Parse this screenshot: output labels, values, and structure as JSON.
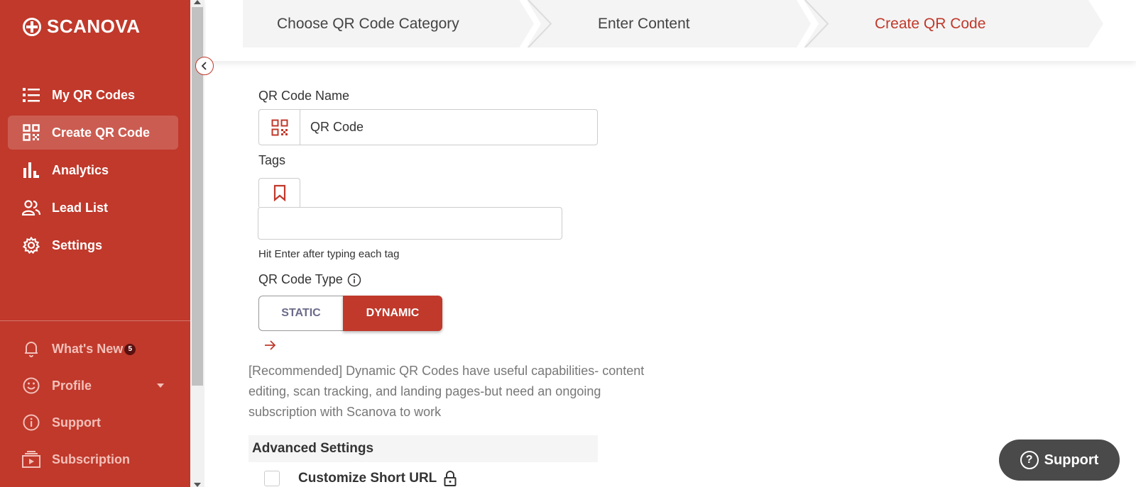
{
  "brand": {
    "name": "SCANOVA"
  },
  "sidebar": {
    "items": [
      {
        "label": "My QR Codes",
        "icon": "list-icon"
      },
      {
        "label": "Create QR Code",
        "icon": "qr-icon",
        "active": true
      },
      {
        "label": "Analytics",
        "icon": "bar-chart-icon"
      },
      {
        "label": "Lead List",
        "icon": "users-icon"
      },
      {
        "label": "Settings",
        "icon": "gear-icon"
      }
    ],
    "bottom": [
      {
        "label": "What's New",
        "icon": "bell-icon",
        "badge": "5"
      },
      {
        "label": "Profile",
        "icon": "smiley-icon"
      },
      {
        "label": "Support",
        "icon": "info-icon"
      },
      {
        "label": "Subscription",
        "icon": "subscription-icon"
      }
    ]
  },
  "stepper": {
    "steps": [
      "Choose QR Code Category",
      "Enter Content",
      "Create QR Code"
    ],
    "active_index": 2
  },
  "form": {
    "name_label": "QR Code Name",
    "name_value": "QR Code",
    "tags_label": "Tags",
    "tags_value": "",
    "tags_hint": "Hit Enter after typing each tag",
    "type_label": "QR Code Type",
    "type_options": [
      "STATIC",
      "DYNAMIC"
    ],
    "type_selected": "DYNAMIC",
    "description": "[Recommended] Dynamic QR Codes have useful capabilities- content editing, scan tracking, and landing pages-but need an ongoing subscription with Scanova to work",
    "advanced_title": "Advanced Settings",
    "customize_short_url": "Customize Short URL"
  },
  "support_button": {
    "label": "Support"
  },
  "colors": {
    "brand": "#c0392b",
    "support_bg": "#4a4a4a"
  }
}
